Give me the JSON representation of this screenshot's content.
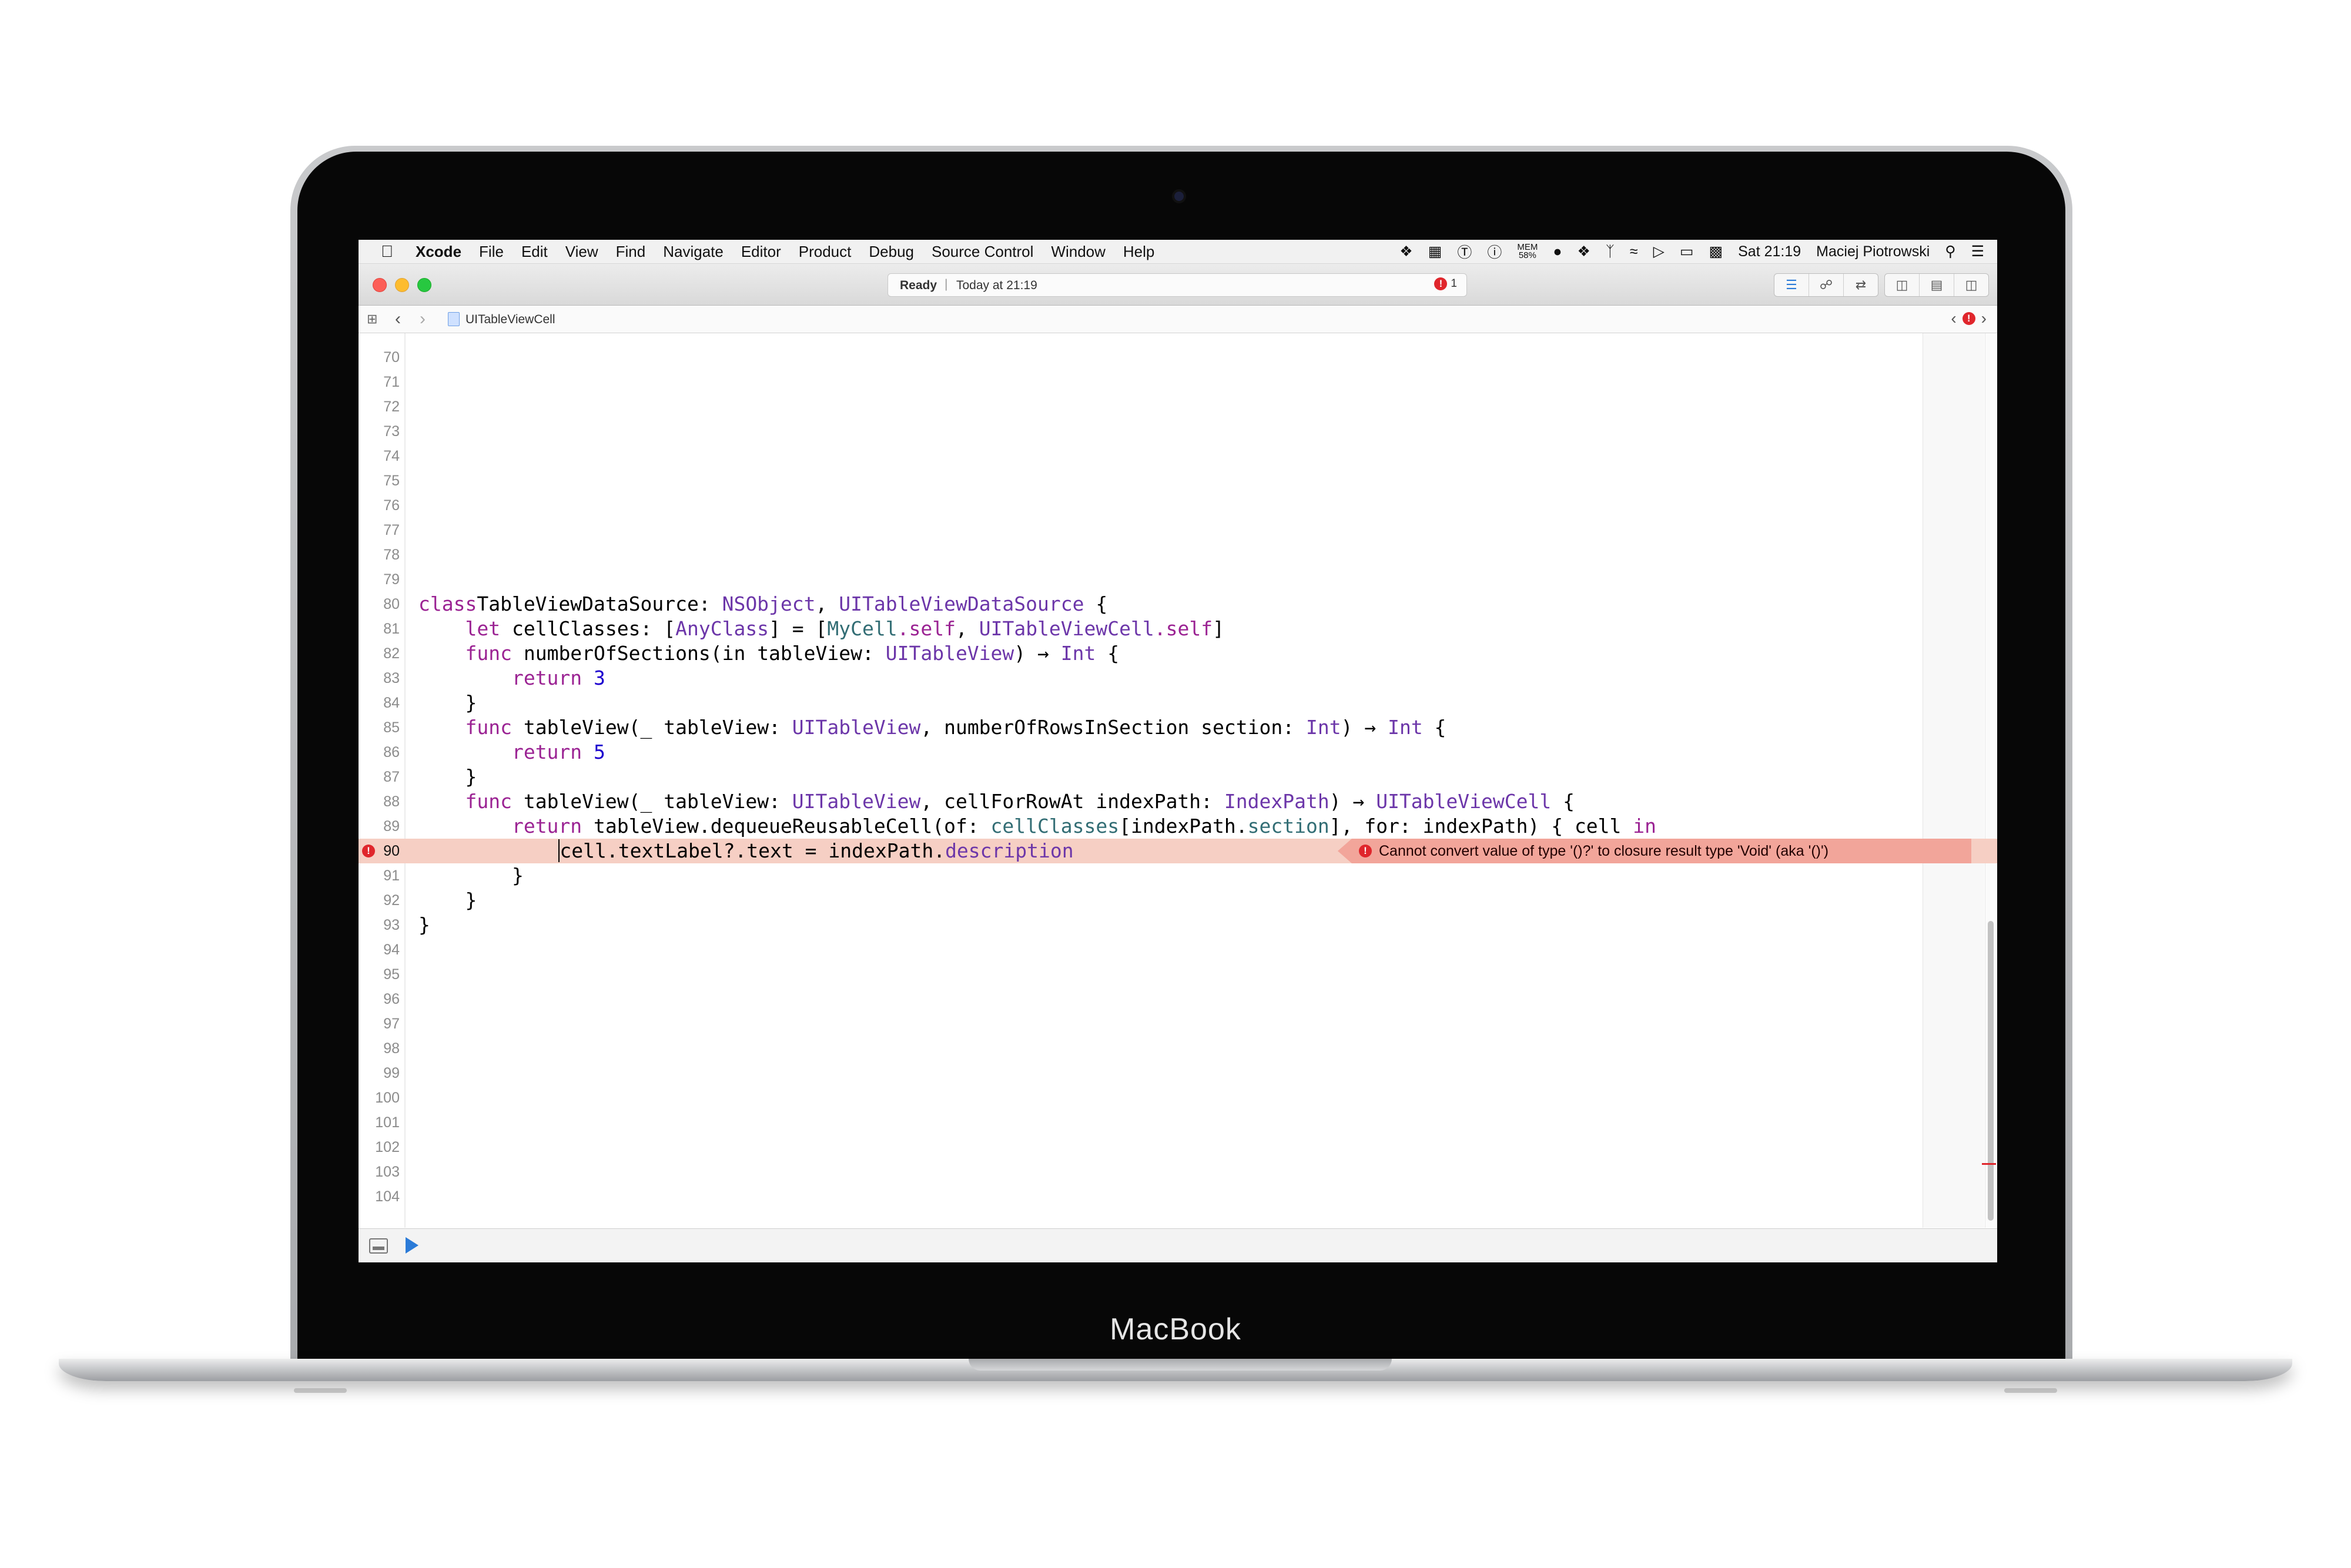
{
  "device": {
    "brand": "MacBook"
  },
  "menubar": {
    "apple_icon": "apple-logo-icon",
    "app_name": "Xcode",
    "items": [
      "File",
      "Edit",
      "View",
      "Find",
      "Navigate",
      "Editor",
      "Product",
      "Debug",
      "Source Control",
      "Window",
      "Help"
    ],
    "memory_label": "MEM",
    "memory_value": "58%",
    "clock": "Sat 21:19",
    "user": "Maciej Piotrowski"
  },
  "titlebar": {
    "status": "Ready",
    "separator": "|",
    "time": "Today at 21:19",
    "error_count": "1",
    "colors": {
      "close": "#fc5e57",
      "minimize": "#fdbc2e",
      "zoom": "#27c840"
    }
  },
  "jumpbar": {
    "file": "UITableViewCell"
  },
  "editor": {
    "lines": [
      {
        "n": "70"
      },
      {
        "n": "71"
      },
      {
        "n": "72"
      },
      {
        "n": "73"
      },
      {
        "n": "74"
      },
      {
        "n": "75"
      },
      {
        "n": "76"
      },
      {
        "n": "77"
      },
      {
        "n": "78"
      },
      {
        "n": "79"
      },
      {
        "n": "80"
      },
      {
        "n": "81"
      },
      {
        "n": "82"
      },
      {
        "n": "83"
      },
      {
        "n": "84"
      },
      {
        "n": "85"
      },
      {
        "n": "86"
      },
      {
        "n": "87"
      },
      {
        "n": "88"
      },
      {
        "n": "89"
      },
      {
        "n": "90"
      },
      {
        "n": "91"
      },
      {
        "n": "92"
      },
      {
        "n": "93"
      },
      {
        "n": "94"
      },
      {
        "n": "95"
      },
      {
        "n": "96"
      },
      {
        "n": "97"
      },
      {
        "n": "98"
      },
      {
        "n": "99"
      },
      {
        "n": "100"
      },
      {
        "n": "101"
      },
      {
        "n": "102"
      },
      {
        "n": "103"
      },
      {
        "n": "104"
      }
    ],
    "code": {
      "l80": [
        [
          "kw",
          "class"
        ],
        [
          "",
          "TableViewDataSource: "
        ],
        [
          "ty",
          "NSObject"
        ],
        [
          "",
          ", "
        ],
        [
          "ty",
          "UITableViewDataSource"
        ],
        [
          "",
          " {"
        ]
      ],
      "l81": [
        [
          "",
          "    "
        ],
        [
          "kw",
          "let"
        ],
        [
          "",
          " cellClasses: ["
        ],
        [
          "ty",
          "AnyClass"
        ],
        [
          "",
          "] = ["
        ],
        [
          "prop",
          "MyCell"
        ],
        [
          "kw",
          ".self"
        ],
        [
          "",
          ", "
        ],
        [
          "ty",
          "UITableViewCell"
        ],
        [
          "kw",
          ".self"
        ],
        [
          "",
          "]"
        ]
      ],
      "l82": [
        [
          "",
          "    "
        ],
        [
          "kw",
          "func"
        ],
        [
          "",
          " numberOfSections(in tableView: "
        ],
        [
          "ty",
          "UITableView"
        ],
        [
          "",
          ") → "
        ],
        [
          "ty",
          "Int"
        ],
        [
          "",
          " {"
        ]
      ],
      "l83": [
        [
          "",
          "        "
        ],
        [
          "kw",
          "return"
        ],
        [
          "",
          " "
        ],
        [
          "num",
          "3"
        ]
      ],
      "l84": [
        [
          "",
          "    }"
        ]
      ],
      "l85": [
        [
          "",
          "    "
        ],
        [
          "kw",
          "func"
        ],
        [
          "",
          " tableView(_ tableView: "
        ],
        [
          "ty",
          "UITableView"
        ],
        [
          "",
          ", numberOfRowsInSection section: "
        ],
        [
          "ty",
          "Int"
        ],
        [
          "",
          ") → "
        ],
        [
          "ty",
          "Int"
        ],
        [
          "",
          " {"
        ]
      ],
      "l86": [
        [
          "",
          "        "
        ],
        [
          "kw",
          "return"
        ],
        [
          "",
          " "
        ],
        [
          "num",
          "5"
        ]
      ],
      "l87": [
        [
          "",
          "    }"
        ]
      ],
      "l88": [
        [
          "",
          "    "
        ],
        [
          "kw",
          "func"
        ],
        [
          "",
          " tableView(_ tableView: "
        ],
        [
          "ty",
          "UITableView"
        ],
        [
          "",
          ", cellForRowAt indexPath: "
        ],
        [
          "ty",
          "IndexPath"
        ],
        [
          "",
          ") → "
        ],
        [
          "ty",
          "UITableViewCell"
        ],
        [
          "",
          " {"
        ]
      ],
      "l89": [
        [
          "",
          "        "
        ],
        [
          "kw",
          "return"
        ],
        [
          "",
          " tableView.dequeueReusableCell(of: "
        ],
        [
          "prop",
          "cellClasses"
        ],
        [
          "",
          "[indexPath."
        ],
        [
          "prop",
          "section"
        ],
        [
          "",
          "], for: indexPath) { cell "
        ],
        [
          "kw",
          "in"
        ]
      ],
      "l90": [
        [
          "",
          "            "
        ],
        [
          "caret",
          ""
        ],
        [
          "",
          "cell.textLabel?.text = indexPath."
        ],
        [
          "prop2",
          "description"
        ]
      ],
      "l91": [
        [
          "",
          "        }"
        ]
      ],
      "l92": [
        [
          "",
          "    }"
        ]
      ],
      "l93": [
        [
          "",
          "}"
        ]
      ]
    },
    "error": {
      "line": "90",
      "message": "Cannot convert value of type '()?' to closure result type 'Void' (aka '()')"
    }
  }
}
